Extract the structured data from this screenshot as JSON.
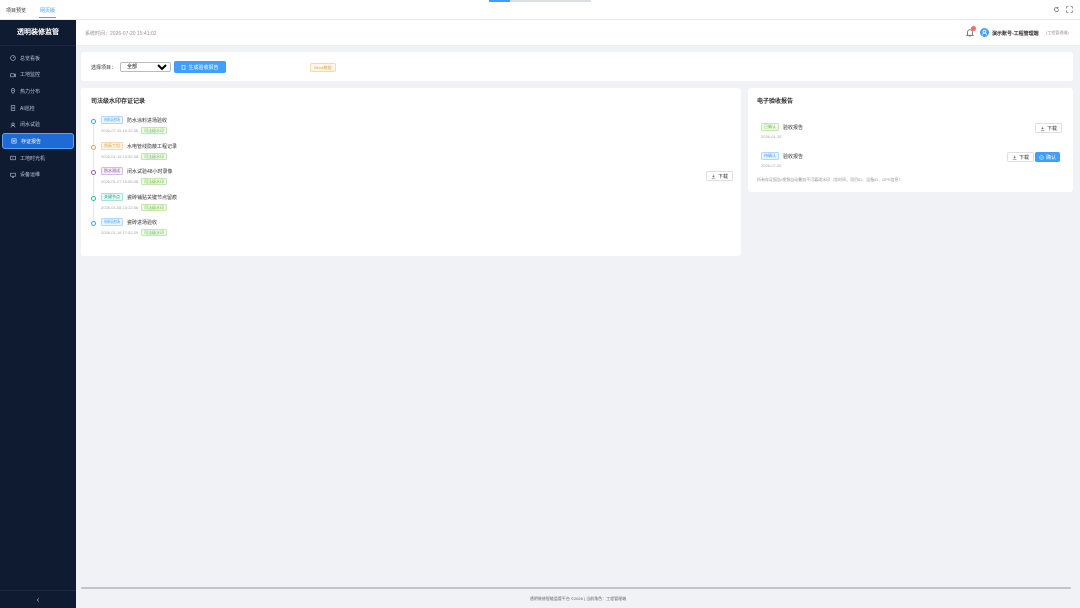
{
  "top_tabs": [
    {
      "label": "项目预览"
    },
    {
      "label": "网页版"
    }
  ],
  "sidebar": {
    "logo": "透明装修监管",
    "items": [
      {
        "label": "总览看板",
        "icon": "dashboard-icon"
      },
      {
        "label": "工地监控",
        "icon": "camera-icon"
      },
      {
        "label": "热力分布",
        "icon": "location-icon"
      },
      {
        "label": "AI巡检",
        "icon": "ai-icon"
      },
      {
        "label": "闭水试验",
        "icon": "water-icon"
      },
      {
        "label": "存证报告",
        "icon": "report-icon"
      },
      {
        "label": "工地时光机",
        "icon": "timeline-icon"
      },
      {
        "label": "设备运维",
        "icon": "device-icon"
      }
    ],
    "active_index": 5
  },
  "header": {
    "system_time": "系统时间：2026-07-20 15:41:02",
    "user_name": "演示账号-工程管理端",
    "user_role": "(工程管理端)"
  },
  "filter": {
    "label": "选择项目：",
    "selected": "全部",
    "generate_button": "生成验收报告",
    "mock_tag": "Mock数据"
  },
  "evidence": {
    "title": "司法级水印存证记录",
    "download_label": "下载",
    "records": [
      {
        "tag": "材料进场",
        "tag_color": "#409eff",
        "name": "防水涂料进场验收",
        "time": "2026-07-15 10:22:36",
        "stamp": "司法级水印"
      },
      {
        "tag": "隐蔽工程",
        "tag_color": "#e6a23c",
        "name": "水电管线隐蔽工程记录",
        "time": "2026-01-15 13:52:08",
        "stamp": "司法级水印"
      },
      {
        "tag": "防水测试",
        "tag_color": "#9b59b6",
        "name": "闭水试验48小时录像",
        "time": "2026-01-27 15:55:38",
        "stamp": "司法级水印"
      },
      {
        "tag": "关键节点",
        "tag_color": "#1abc9c",
        "name": "瓷砖铺贴关键节点留痕",
        "time": "2026-01-08 13:22:36",
        "stamp": "司法级水印"
      },
      {
        "tag": "材料进场",
        "tag_color": "#409eff",
        "name": "瓷砖进场验收",
        "time": "2026-01-18 17:52:29",
        "stamp": "司法级水印"
      }
    ]
  },
  "reports": {
    "title": "电子验收报告",
    "download_label": "下载",
    "confirm_label": "确认",
    "items": [
      {
        "status": "已确认",
        "status_color": "#67c23a",
        "name": "验收报告",
        "date": "2026-01-15",
        "confirmable": false
      },
      {
        "status": "待确认",
        "status_color": "#409eff",
        "name": "验收报告",
        "date": "2026-07-20",
        "confirmable": true
      }
    ],
    "note": "所有存证报告/视频自动叠加不可篡改水印（含时间、项目ID、设备ID、GPS信息）"
  },
  "footer": {
    "text": "透明装修智能监管平台 ©2026 | 当前角色：工程管理端"
  }
}
